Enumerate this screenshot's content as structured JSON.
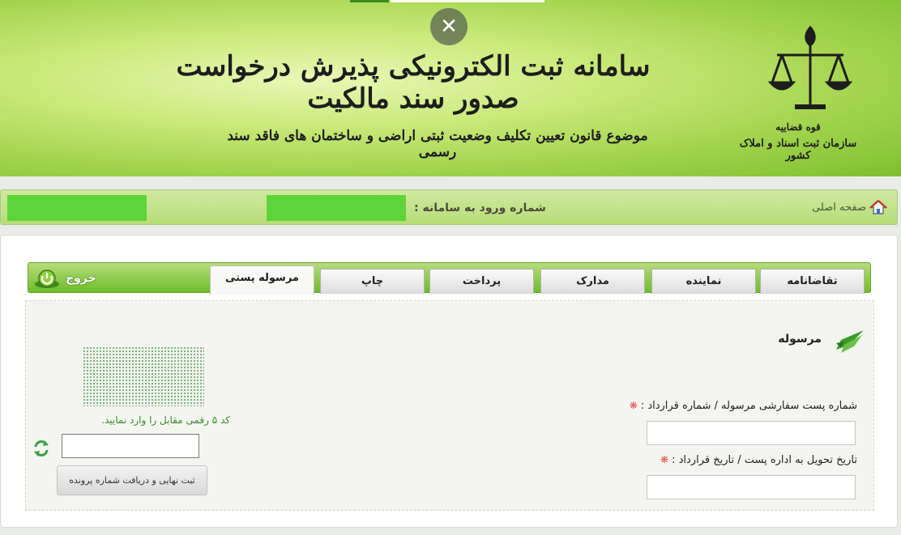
{
  "banner": {
    "title": "سامانه ثبت الکترونیکی پذیرش درخواست صدور سند مالکیت",
    "subtitle": "موضوع قانون تعیین تکلیف وضعیت ثبتی اراضی و ساختمان های فاقد سند رسمی",
    "emblem_line1": "قوه قضاییه",
    "emblem_line2": "سازمان ثبت اسناد و املاک کشور",
    "close_glyph": "✕"
  },
  "infobar": {
    "home_label": "صفحه اصلی",
    "login_number_label": "شماره ورود به سامانه :"
  },
  "tabs": [
    {
      "label": "تقاضانامه"
    },
    {
      "label": "نماینده"
    },
    {
      "label": "مدارک"
    },
    {
      "label": "پرداخت"
    },
    {
      "label": "چاپ"
    },
    {
      "label": "مرسوله پستی"
    }
  ],
  "active_tab": "مرسوله پستی",
  "logout_label": "خروج",
  "form": {
    "section_title": "مرسوله",
    "tracking_label": "شماره پست سفارشی مرسوله / شماره قرارداد :",
    "delivery_label": "تاریخ تحویل به اداره پست / تاریخ قرارداد :",
    "required_mark": "❋",
    "captcha_hint": "کد ۵ رقمی مقابل را وارد نمایید.",
    "submit_label": "ثبت نهایی و دریافت شماره پرونده"
  },
  "colors": {
    "accent_green": "#6ebc2a",
    "redacted_green": "#5fd43a",
    "required_red": "#e05050",
    "hint_green": "#3a8a2a"
  },
  "icons": {
    "home": "home-icon",
    "logout": "power-icon",
    "section": "post-bird-icon",
    "refresh": "refresh-icon",
    "close": "close-icon"
  }
}
